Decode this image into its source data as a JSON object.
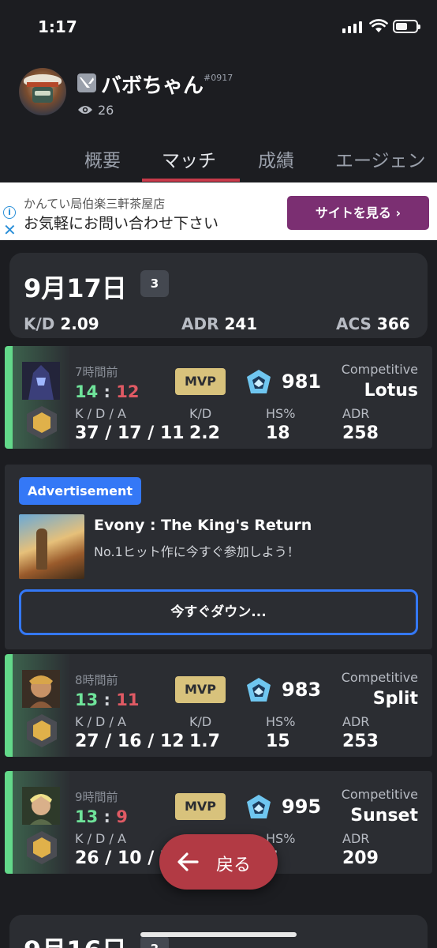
{
  "status": {
    "time": "1:17"
  },
  "profile": {
    "name": "バボちゃん",
    "tag": "#0917",
    "views": "26"
  },
  "tabs": [
    "概要",
    "マッチ",
    "成績",
    "エージェン"
  ],
  "banner_ad": {
    "line1": "かんてい局伯楽三軒茶屋店",
    "line2": "お気軽にお問い合わせ下さい",
    "cta": "サイトを見る ›"
  },
  "day": {
    "date": "9月17日",
    "count": "3",
    "kd_label": "K/D",
    "kd": "2.09",
    "adr_label": "ADR",
    "adr": "241",
    "acs_label": "ACS",
    "acs": "366"
  },
  "labels": {
    "kda": "K / D / A",
    "kd": "K/D",
    "hs": "HS%",
    "adr": "ADR",
    "sep": ":"
  },
  "matches": [
    {
      "ago": "7時間前",
      "won": "14",
      "lost": "12",
      "mvp": "MVP",
      "rr": "981",
      "mode": "Competitive",
      "map": "Lotus",
      "kda": "37 / 17 / 11",
      "kd": "2.2",
      "hs": "18",
      "adr": "258",
      "agent_color": "#3b3f7a"
    },
    {
      "ago": "8時間前",
      "won": "13",
      "lost": "11",
      "mvp": "MVP",
      "rr": "983",
      "mode": "Competitive",
      "map": "Split",
      "kda": "27 / 16 / 12",
      "kd": "1.7",
      "hs": "15",
      "adr": "253",
      "agent_color": "#b8864e"
    },
    {
      "ago": "9時間前",
      "won": "13",
      "lost": "9",
      "mvp": "MVP",
      "rr": "995",
      "mode": "Competitive",
      "map": "Sunset",
      "kda": "26 / 10 / 7",
      "kd": "",
      "hs": "7",
      "adr": "209",
      "agent_color": "#c9a86a"
    }
  ],
  "native_ad": {
    "badge": "Advertisement",
    "title": "Evony : The King's Return",
    "desc": "No.1ヒット作に今すぐ参加しよう！",
    "button": "今すぐダウン..."
  },
  "back_button": {
    "label": "戻る"
  },
  "day2": {
    "date": "9月16日",
    "count": "2"
  },
  "colors": {
    "win": "#6fe39a",
    "loss": "#e05a64",
    "accent": "#c83a4a",
    "mvp": "#d8c27c",
    "ad_blue": "#3478f6"
  }
}
